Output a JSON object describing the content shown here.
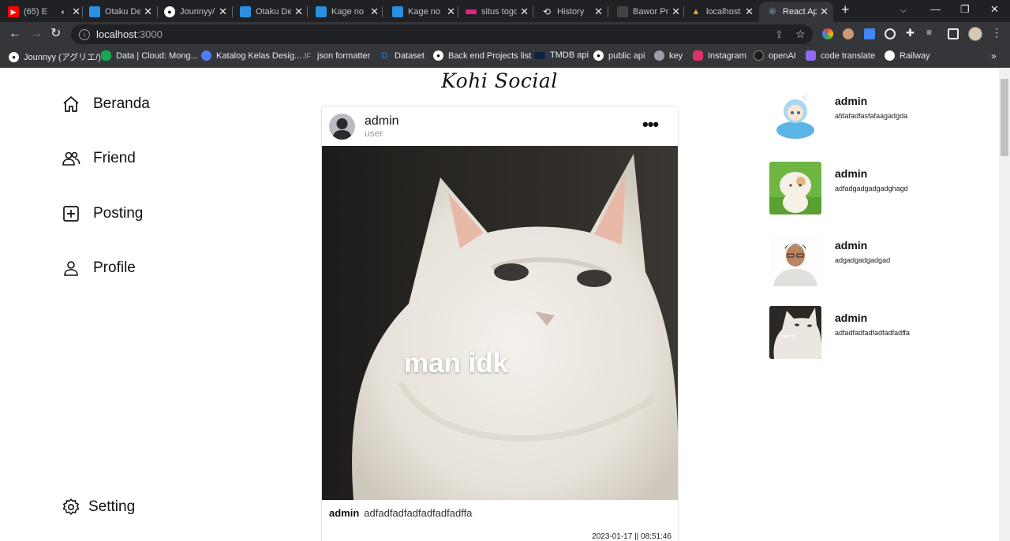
{
  "browser": {
    "tabs": [
      {
        "title": "(65) E",
        "favicon": "youtube-icon",
        "color": "#ff0000",
        "audio": true
      },
      {
        "title": "Otaku De",
        "favicon": "site-icon",
        "color": "#2a8fe0"
      },
      {
        "title": "Jounnyy/",
        "favicon": "github-icon",
        "color": "#ffffff"
      },
      {
        "title": "Otaku De",
        "favicon": "site-icon",
        "color": "#2a8fe0"
      },
      {
        "title": "Kage no",
        "favicon": "site-icon",
        "color": "#2a8fe0"
      },
      {
        "title": "Kage no",
        "favicon": "site-icon",
        "color": "#2a8fe0"
      },
      {
        "title": "situs togo",
        "favicon": "flag-icon",
        "color": "#e0267d"
      },
      {
        "title": "History",
        "favicon": "history-icon",
        "color": "#e8eaed"
      },
      {
        "title": "Bawor Pr",
        "favicon": "site-icon",
        "color": "#444"
      },
      {
        "title": "localhost",
        "favicon": "site-icon",
        "color": "#f0a030"
      },
      {
        "title": "React App",
        "favicon": "react-icon",
        "color": "#61dafb",
        "active": true
      }
    ],
    "address": {
      "host": "localhost",
      "port": ":3000"
    },
    "bookmarks": [
      {
        "label": "Jounnyy (アグリエ/)",
        "icon": "github-icon",
        "color": "#ffffff"
      },
      {
        "label": "Data | Cloud: Mong...",
        "icon": "mongodb-icon",
        "color": "#13aa52"
      },
      {
        "label": "Katalog Kelas Desig...",
        "icon": "site-icon",
        "color": "#4f7df5"
      },
      {
        "label": "json formatter",
        "icon": "jf-icon",
        "color": "#555"
      },
      {
        "label": "Dataset",
        "icon": "dataset-icon",
        "color": "#1e88e5"
      },
      {
        "label": "Back end Projects list",
        "icon": "github-icon",
        "color": "#ffffff"
      },
      {
        "label": "TMDB api",
        "icon": "tmdb-icon",
        "color": "#0d253f"
      },
      {
        "label": "public api",
        "icon": "github-icon",
        "color": "#ffffff"
      },
      {
        "label": "key",
        "icon": "globe-icon",
        "color": "#9aa0a6"
      },
      {
        "label": "Instagram",
        "icon": "instagram-icon",
        "color": "#e1306c"
      },
      {
        "label": "openAI",
        "icon": "openai-icon",
        "color": "#1a1a1a"
      },
      {
        "label": "code translate",
        "icon": "site-icon",
        "color": "#8e6cef"
      },
      {
        "label": "Railway",
        "icon": "railway-icon",
        "color": "#ffffff"
      }
    ]
  },
  "app": {
    "logo": "Kohi Social",
    "nav": [
      {
        "label": "Beranda",
        "icon": "home-icon"
      },
      {
        "label": "Friend",
        "icon": "friends-icon"
      },
      {
        "label": "Posting",
        "icon": "add-post-icon"
      },
      {
        "label": "Profile",
        "icon": "profile-icon"
      }
    ],
    "setting": {
      "label": "Setting",
      "icon": "gear-icon"
    },
    "post": {
      "author": "admin",
      "role": "user",
      "image_text": "man idk",
      "caption_author": "admin",
      "caption": "adfadfadfadfadfadfadffa",
      "timestamp": "2023-01-17 || 08:51:46"
    },
    "sidebar_posts": [
      {
        "name": "admin",
        "desc": "afdafadfasfafaagadgda"
      },
      {
        "name": "admin",
        "desc": "adfadgadgadgadghagd"
      },
      {
        "name": "admin",
        "desc": "adgadgadgadgad"
      },
      {
        "name": "admin",
        "desc": "adfadfadfadfadfadfadffa",
        "thumb_text": "man idk"
      }
    ]
  }
}
